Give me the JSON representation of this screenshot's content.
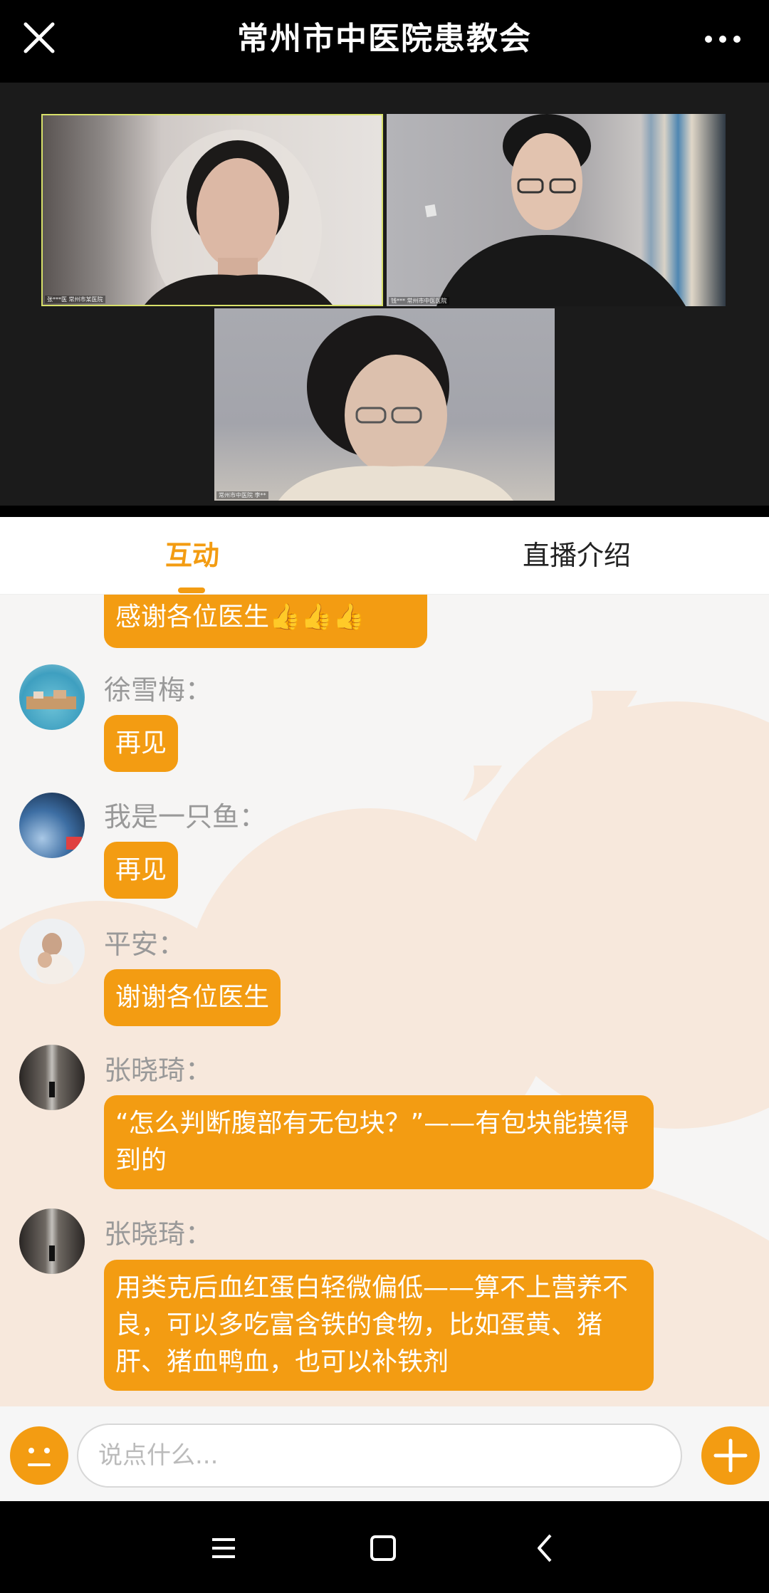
{
  "header": {
    "title": "常州市中医院患教会",
    "close_icon": "close-icon",
    "more_icon": "more-dots-icon"
  },
  "video": {
    "tiles": [
      {
        "caption": "张***医 常州市某医院"
      },
      {
        "caption": "钱*** 常州市中医医院"
      },
      {
        "caption": "常州市中医院 李**"
      }
    ]
  },
  "tabs": [
    {
      "label": "互动",
      "active": true
    },
    {
      "label": "直播介绍",
      "active": false
    }
  ],
  "chat": {
    "messages": [
      {
        "text": "感谢各位医生👍👍👍"
      },
      {
        "user": "徐雪梅：",
        "text": "再见"
      },
      {
        "user": "我是一只鱼：",
        "text": "再见"
      },
      {
        "user": "平安：",
        "text": "谢谢各位医生"
      },
      {
        "user": "张晓琦：",
        "text": "“怎么判断腹部有无包块？”——有包块能摸得到的"
      },
      {
        "user": "张晓琦：",
        "text": "用类克后血红蛋白轻微偏低——算不上营养不良，可以多吃富含铁的食物，比如蛋黄、猪肝、猪血鸭血，也可以补铁剂"
      }
    ]
  },
  "composer": {
    "placeholder": "说点什么...",
    "emoji_icon": "emoji-icon",
    "plus_icon": "plus-icon"
  },
  "colors": {
    "accent": "#f39c12",
    "titlebar_bg": "#000000"
  }
}
